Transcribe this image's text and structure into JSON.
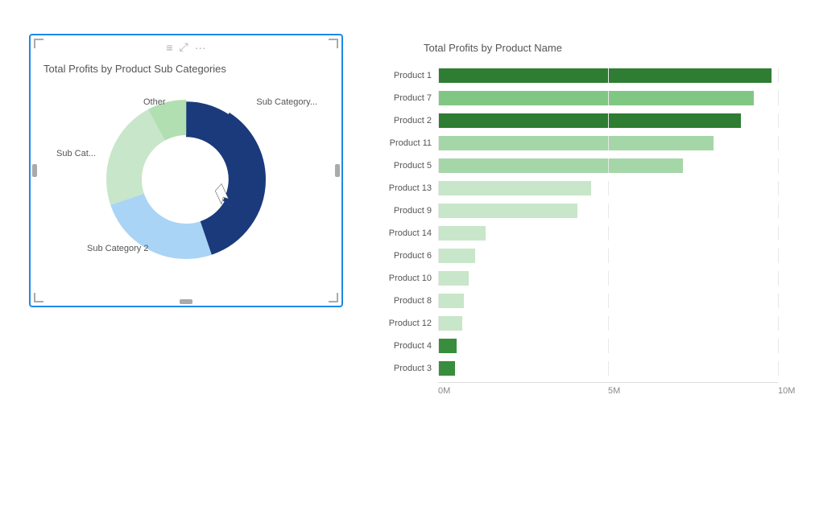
{
  "donut": {
    "title": "Total Profits by Product Sub Categories",
    "labels": {
      "other": "Other",
      "subCatRight": "Sub Category...",
      "subCatLeft": "Sub Cat...",
      "subCat2": "Sub Category 2"
    },
    "segments": [
      {
        "name": "Sub Category 1 (dark blue)",
        "color": "#1a3a7c",
        "startAngle": -90,
        "endAngle": 60
      },
      {
        "name": "Sub Category 2 (light blue)",
        "color": "#aad4f5",
        "startAngle": 60,
        "endAngle": 180
      },
      {
        "name": "Sub Cat (light green)",
        "color": "#c8e6c9",
        "startAngle": 180,
        "endAngle": 295
      },
      {
        "name": "Other (medium green)",
        "color": "#b2dfb2",
        "startAngle": 295,
        "endAngle": 360
      }
    ]
  },
  "barChart": {
    "title": "Total Profits by Product Name",
    "xAxisLabels": [
      "0M",
      "5M",
      "10M"
    ],
    "maxValue": 10,
    "products": [
      {
        "name": "Product 1",
        "value": 9.8,
        "color": "#2e7d32"
      },
      {
        "name": "Product 7",
        "value": 9.3,
        "color": "#81c784"
      },
      {
        "name": "Product 2",
        "value": 8.9,
        "color": "#2e7d32"
      },
      {
        "name": "Product 11",
        "value": 8.1,
        "color": "#a5d6a7"
      },
      {
        "name": "Product 5",
        "value": 7.2,
        "color": "#a5d6a7"
      },
      {
        "name": "Product 13",
        "value": 4.5,
        "color": "#c8e6c9"
      },
      {
        "name": "Product 9",
        "value": 4.1,
        "color": "#c8e6c9"
      },
      {
        "name": "Product 14",
        "value": 1.4,
        "color": "#c8e6c9"
      },
      {
        "name": "Product 6",
        "value": 1.1,
        "color": "#c8e6c9"
      },
      {
        "name": "Product 10",
        "value": 0.9,
        "color": "#c8e6c9"
      },
      {
        "name": "Product 8",
        "value": 0.75,
        "color": "#c8e6c9"
      },
      {
        "name": "Product 12",
        "value": 0.7,
        "color": "#c8e6c9"
      },
      {
        "name": "Product 4",
        "value": 0.55,
        "color": "#388e3c"
      },
      {
        "name": "Product 3",
        "value": 0.5,
        "color": "#388e3c"
      }
    ]
  },
  "toolbar": {
    "menuIcon": "≡",
    "expandIcon": "⤢",
    "moreIcon": "···"
  }
}
